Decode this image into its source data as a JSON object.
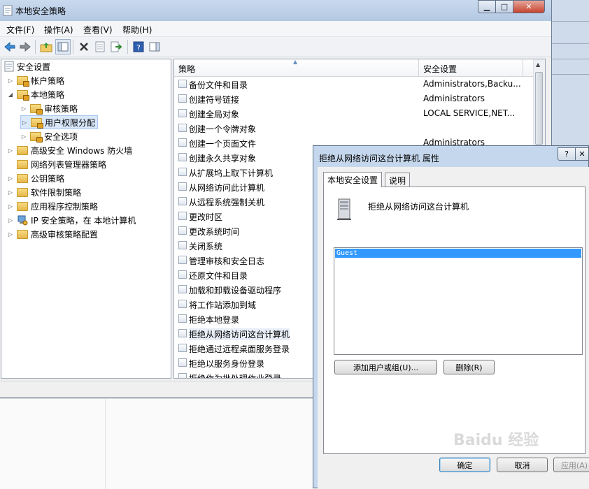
{
  "window": {
    "title": "本地安全策略",
    "min_glyph": "▁",
    "max_glyph": "□",
    "close_glyph": "✕"
  },
  "menu": {
    "file": "文件(F)",
    "action": "操作(A)",
    "view": "查看(V)",
    "help": "帮助(H)"
  },
  "tree": {
    "items": [
      {
        "label": "安全设置"
      },
      {
        "label": "帐户策略"
      },
      {
        "label": "本地策略"
      },
      {
        "label": "审核策略"
      },
      {
        "label": "用户权限分配"
      },
      {
        "label": "安全选项"
      },
      {
        "label": "高级安全 Windows 防火墙"
      },
      {
        "label": "网络列表管理器策略"
      },
      {
        "label": "公钥策略"
      },
      {
        "label": "软件限制策略"
      },
      {
        "label": "应用程序控制策略"
      },
      {
        "label": "IP 安全策略，在 本地计算机"
      },
      {
        "label": "高级审核策略配置"
      }
    ]
  },
  "list": {
    "col_policy": "策略",
    "col_setting": "安全设置",
    "rows": [
      {
        "name": "备份文件和目录",
        "setting": "Administrators,Backu..."
      },
      {
        "name": "创建符号链接",
        "setting": "Administrators"
      },
      {
        "name": "创建全局对象",
        "setting": "LOCAL SERVICE,NET..."
      },
      {
        "name": "创建一个令牌对象",
        "setting": ""
      },
      {
        "name": "创建一个页面文件",
        "setting": "Administrators"
      },
      {
        "name": "创建永久共享对象",
        "setting": ""
      },
      {
        "name": "从扩展坞上取下计算机",
        "setting": ""
      },
      {
        "name": "从网络访问此计算机",
        "setting": ""
      },
      {
        "name": "从远程系统强制关机",
        "setting": ""
      },
      {
        "name": "更改时区",
        "setting": ""
      },
      {
        "name": "更改系统时间",
        "setting": ""
      },
      {
        "name": "关闭系统",
        "setting": ""
      },
      {
        "name": "管理审核和安全日志",
        "setting": ""
      },
      {
        "name": "还原文件和目录",
        "setting": ""
      },
      {
        "name": "加载和卸载设备驱动程序",
        "setting": ""
      },
      {
        "name": "将工作站添加到域",
        "setting": ""
      },
      {
        "name": "拒绝本地登录",
        "setting": ""
      },
      {
        "name": "拒绝从网络访问这台计算机",
        "setting": ""
      },
      {
        "name": "拒绝通过远程桌面服务登录",
        "setting": ""
      },
      {
        "name": "拒绝以服务身份登录",
        "setting": ""
      },
      {
        "name": "拒绝作为批处理作业登录",
        "setting": ""
      }
    ]
  },
  "dialog": {
    "title": "拒绝从网络访问这台计算机 属性",
    "help_glyph": "?",
    "close_glyph": "✕",
    "tab_local": "本地安全设置",
    "tab_explain": "说明",
    "heading": "拒绝从网络访问这台计算机",
    "users": [
      "Guest"
    ],
    "btn_add": "添加用户或组(U)...",
    "btn_remove": "删除(R)",
    "btn_ok": "确定",
    "btn_cancel": "取消",
    "btn_apply": "应用(A)"
  },
  "watermark": "Baidu 经验"
}
